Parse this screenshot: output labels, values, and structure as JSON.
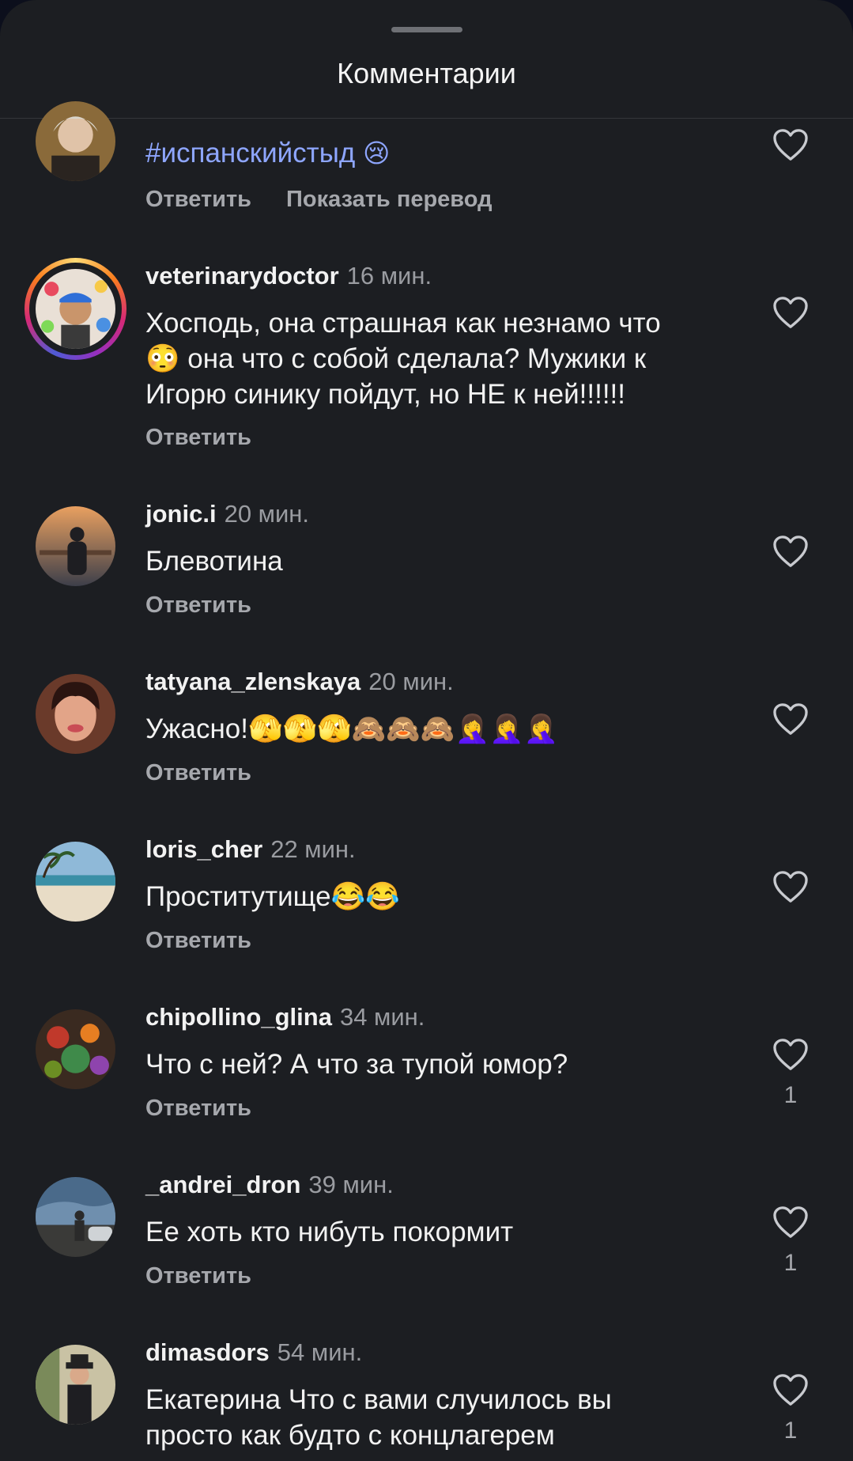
{
  "header": {
    "title": "Комментарии"
  },
  "comments": [
    {
      "username": "",
      "time": "",
      "text": "#испанскийстыд",
      "text_emoji": "😢",
      "actions": [
        "Ответить",
        "Показать перевод"
      ],
      "likes": ""
    },
    {
      "username": "veterinarydoctor",
      "time": "16 мин.",
      "text_lines": [
        "Хосподь, она страшная как незнамо что",
        "😳 она что с собой сделала? Мужики к",
        "Игорю синику пойдут, но НЕ к ней!!!!!!"
      ],
      "actions": [
        "Ответить"
      ],
      "likes": ""
    },
    {
      "username": "jonic.i",
      "time": "20 мин.",
      "text": "Блевотина",
      "actions": [
        "Ответить"
      ],
      "likes": ""
    },
    {
      "username": "tatyana_zlenskaya",
      "time": "20 мин.",
      "text": "Ужасно!🫣🫣🫣🙈🙈🙈🤦‍♀️🤦‍♀️🤦‍♀️",
      "actions": [
        "Ответить"
      ],
      "likes": ""
    },
    {
      "username": "loris_cher",
      "time": "22 мин.",
      "text": "Проститутище😂😂",
      "actions": [
        "Ответить"
      ],
      "likes": ""
    },
    {
      "username": "chipollino_glina",
      "time": "34 мин.",
      "text": "Что с ней? А что за тупой юмор?",
      "actions": [
        "Ответить"
      ],
      "likes": "1"
    },
    {
      "username": "_andrei_dron",
      "time": "39 мин.",
      "text": "Ее хоть кто нибуть покормит",
      "actions": [
        "Ответить"
      ],
      "likes": "1"
    },
    {
      "username": "dimasdors",
      "time": "54 мин.",
      "text_lines": [
        "Екатерина Что с вами случилось вы",
        "просто как будто с концлагерем"
      ],
      "actions": [],
      "likes": "1"
    }
  ],
  "colors": {
    "background": "#1c1e22",
    "hashtag": "#8ea6ff",
    "muted": "#9a9ca1"
  },
  "icons": {
    "like": "heart-outline-icon"
  }
}
